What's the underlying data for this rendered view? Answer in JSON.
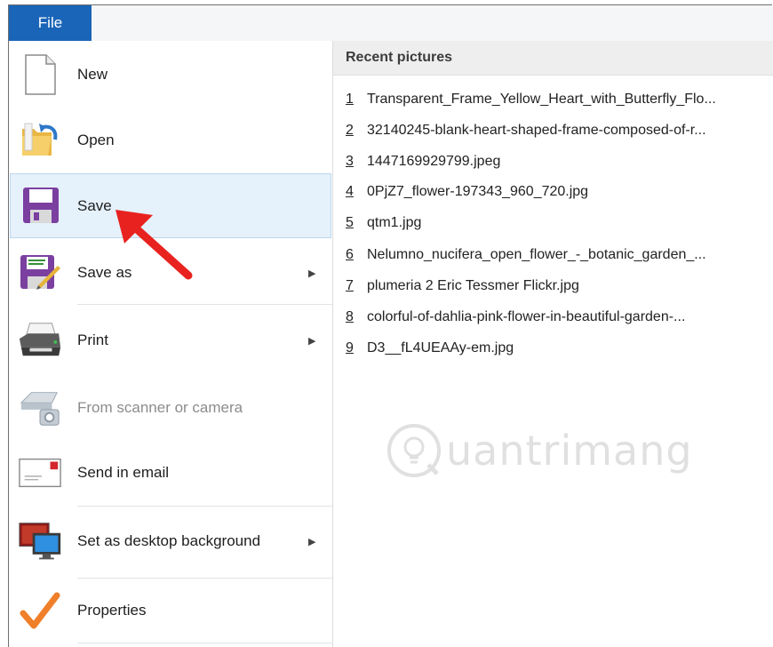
{
  "ribbon": {
    "file_tab": "File"
  },
  "menu": {
    "items": [
      {
        "id": "new",
        "label": "New",
        "icon": "new-document-icon"
      },
      {
        "id": "open",
        "label": "Open",
        "icon": "folder-open-icon"
      },
      {
        "id": "save",
        "label": "Save",
        "icon": "floppy-disk-icon",
        "selected": true
      },
      {
        "id": "save-as",
        "label": "Save as",
        "icon": "save-as-icon",
        "submenu": true
      },
      {
        "id": "print",
        "label": "Print",
        "icon": "printer-icon",
        "submenu": true
      },
      {
        "id": "scanner",
        "label": "From scanner or camera",
        "icon": "scanner-camera-icon",
        "disabled": true
      },
      {
        "id": "email",
        "label": "Send in email",
        "icon": "email-icon"
      },
      {
        "id": "desktop-bg",
        "label": "Set as desktop background",
        "icon": "desktop-background-icon",
        "submenu": true
      },
      {
        "id": "properties",
        "label": "Properties",
        "icon": "checkmark-icon"
      }
    ]
  },
  "recent": {
    "header": "Recent pictures",
    "items": [
      {
        "num": "1",
        "name": "Transparent_Frame_Yellow_Heart_with_Butterfly_Flo..."
      },
      {
        "num": "2",
        "name": "32140245-blank-heart-shaped-frame-composed-of-r..."
      },
      {
        "num": "3",
        "name": "1447169929799.jpeg"
      },
      {
        "num": "4",
        "name": "0PjZ7_flower-197343_960_720.jpg"
      },
      {
        "num": "5",
        "name": "qtm1.jpg"
      },
      {
        "num": "6",
        "name": "Nelumno_nucifera_open_flower_-_botanic_garden_..."
      },
      {
        "num": "7",
        "name": "plumeria 2 Eric Tessmer Flickr.jpg"
      },
      {
        "num": "8",
        "name": "colorful-of-dahlia-pink-flower-in-beautiful-garden-..."
      },
      {
        "num": "9",
        "name": "D3__fL4UEAAy-em.jpg"
      }
    ]
  },
  "watermark": {
    "text": "uantrimang"
  },
  "colors": {
    "file_tab": "#1a65b8",
    "selected_bg": "#e5f1fb",
    "arrow": "#e8231f"
  }
}
